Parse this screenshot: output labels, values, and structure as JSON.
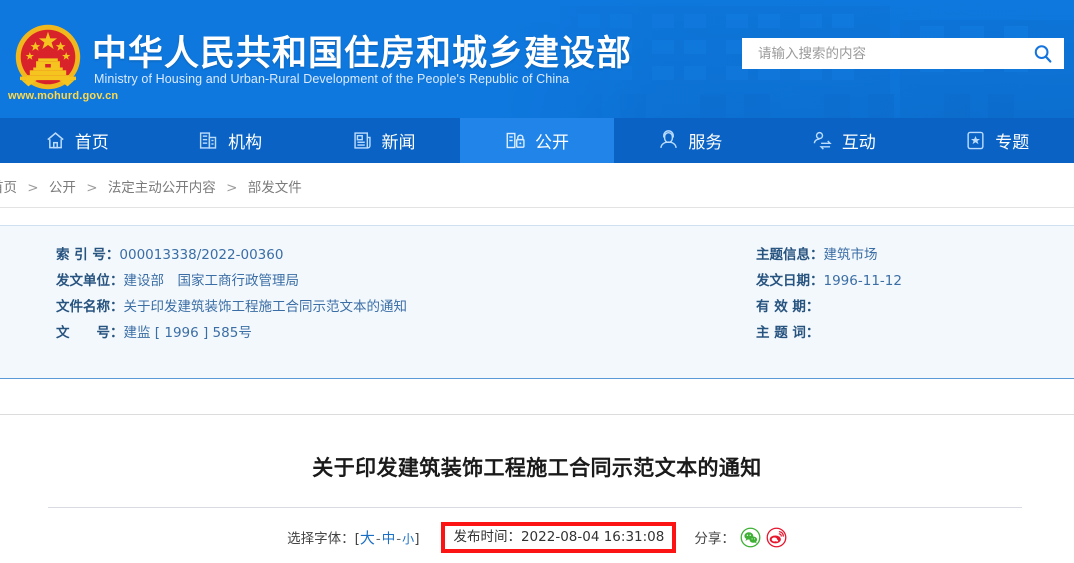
{
  "header": {
    "title_cn": "中华人民共和国住房和城乡建设部",
    "title_en": "Ministry of Housing and Urban-Rural Development of the People's Republic of China",
    "url": "www.mohurd.gov.cn",
    "emblem_icon": "national-emblem-icon",
    "colors": {
      "header_blue": "#0e78de",
      "nav_blue": "#0a63c4",
      "nav_active_blue": "#2084e8",
      "url_yellow": "#ffd94a"
    }
  },
  "search": {
    "placeholder": "请输入搜索的内容",
    "value": "",
    "icon": "search-icon"
  },
  "nav": {
    "items": [
      {
        "label": "首页",
        "icon": "home-icon",
        "active": false
      },
      {
        "label": "机构",
        "icon": "building-icon",
        "active": false
      },
      {
        "label": "新闻",
        "icon": "news-icon",
        "active": false
      },
      {
        "label": "公开",
        "icon": "open-document-icon",
        "active": true
      },
      {
        "label": "服务",
        "icon": "service-person-icon",
        "active": false
      },
      {
        "label": "互动",
        "icon": "interaction-icon",
        "active": false
      },
      {
        "label": "专题",
        "icon": "star-card-icon",
        "active": false
      }
    ]
  },
  "breadcrumb": {
    "items": [
      "首页",
      "公开",
      "法定主动公开内容",
      "部发文件"
    ],
    "separator": ">"
  },
  "meta": {
    "left": [
      {
        "label": "索 引 号：",
        "value": "000013338/2022-00360"
      },
      {
        "label": "发文单位：",
        "value": "建设部　国家工商行政管理局"
      },
      {
        "label": "文件名称：",
        "value": "关于印发建筑装饰工程施工合同示范文本的通知"
      },
      {
        "label": "文　　号：",
        "value": "建监 [ 1996 ] 585号"
      }
    ],
    "right": [
      {
        "label": "主题信息：",
        "value": "建筑市场"
      },
      {
        "label": "发文日期：",
        "value": "1996-11-12"
      },
      {
        "label": "有 效 期：",
        "value": ""
      },
      {
        "label": "主 题 词：",
        "value": ""
      }
    ]
  },
  "article": {
    "title": "关于印发建筑装饰工程施工合同示范文本的通知"
  },
  "toolbar": {
    "font_label": "选择字体：[",
    "font_large": "大",
    "font_medium": "中",
    "font_small": "小",
    "font_close": "]",
    "dash": "-",
    "publish_time": "发布时间：2022-08-04 16:31:08",
    "highlight_color": "#fc1414",
    "share_label": "分享：",
    "share_items": [
      {
        "icon": "wechat-icon",
        "color": "#3eb135"
      },
      {
        "icon": "weibo-icon",
        "color": "#e6162d"
      }
    ]
  }
}
